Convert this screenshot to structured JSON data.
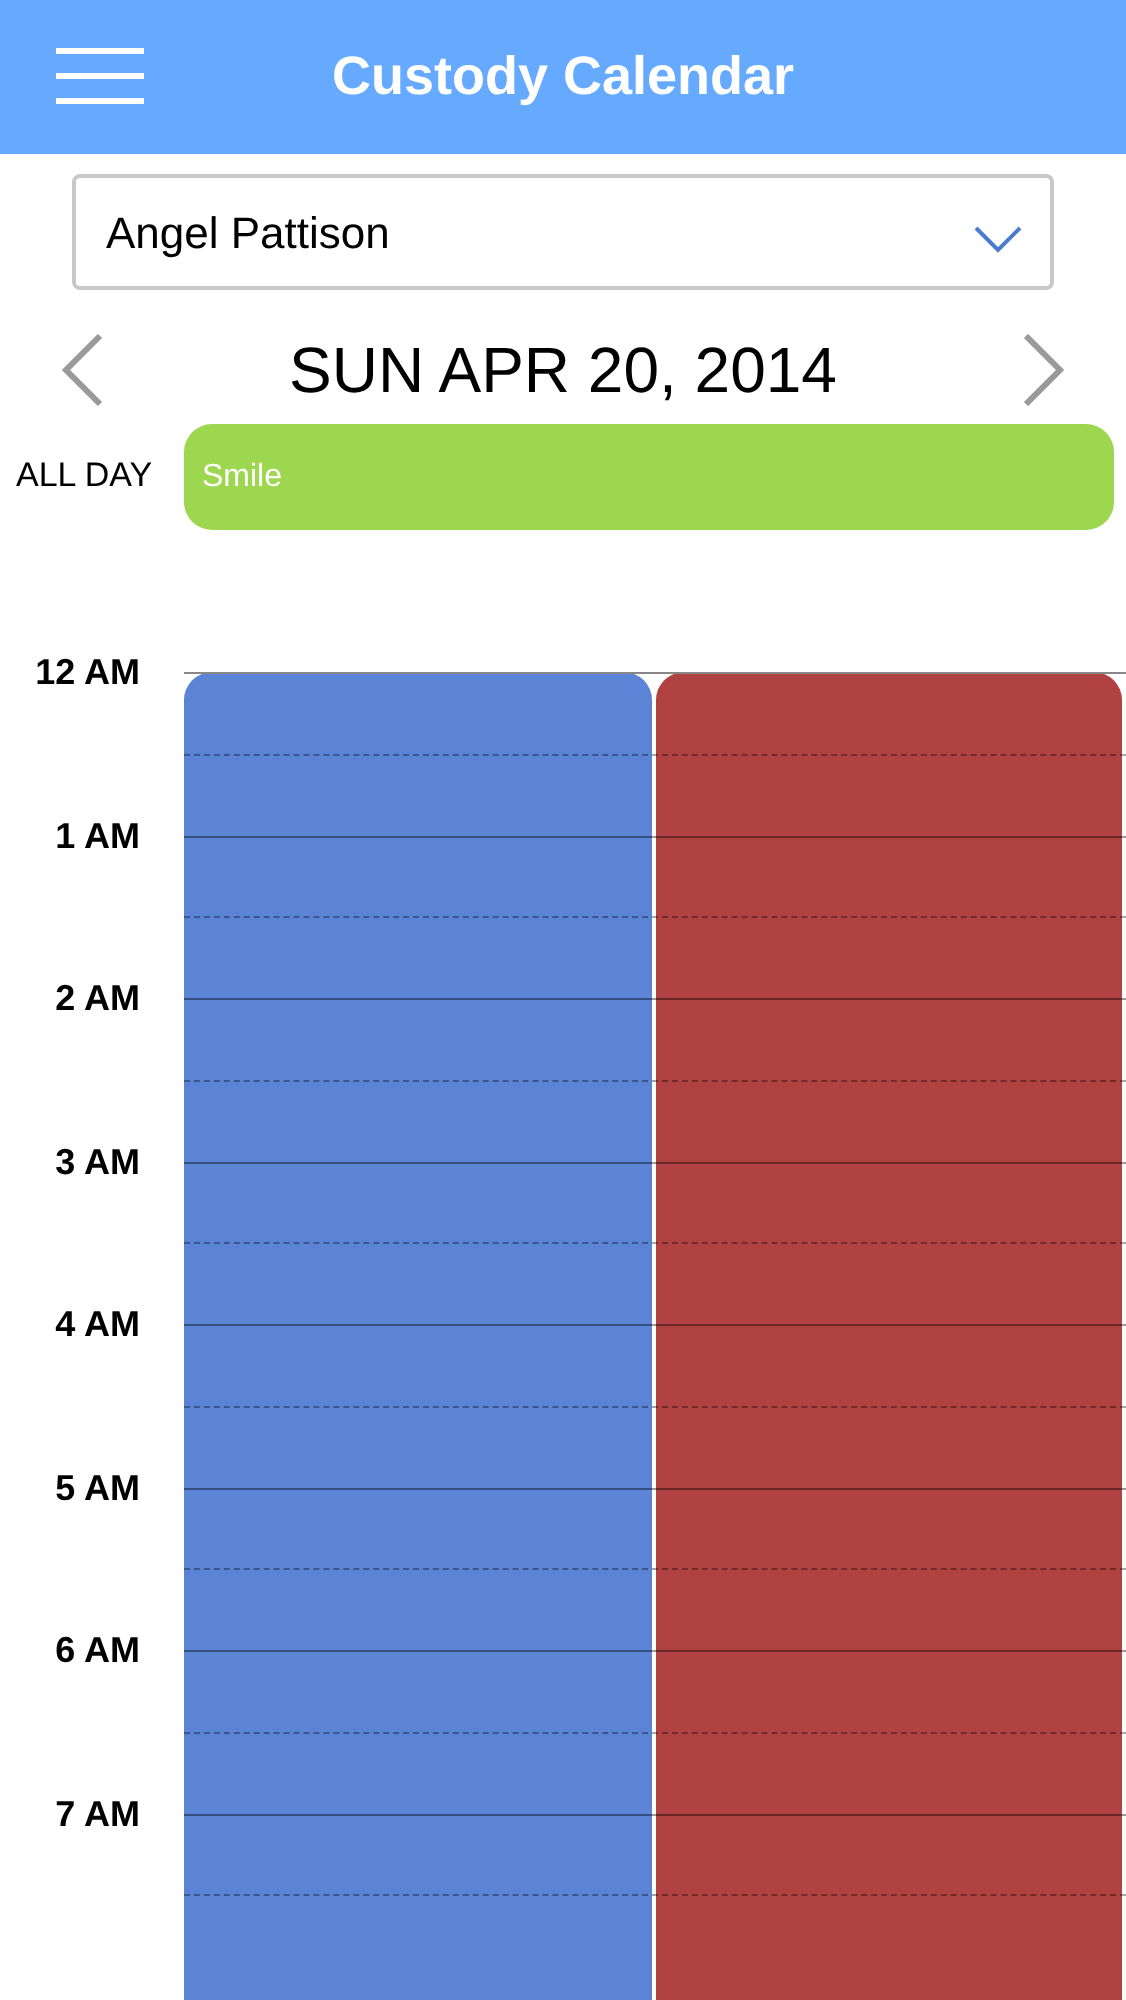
{
  "header": {
    "title": "Custody Calendar"
  },
  "person_select": {
    "value": "Angel Pattison"
  },
  "date_nav": {
    "date": "SUN APR 20, 2014"
  },
  "all_day": {
    "label": "ALL DAY",
    "events": [
      {
        "title": "Smile",
        "color": "#9dd64f"
      }
    ]
  },
  "hours": [
    "12 AM",
    "1 AM",
    "2 AM",
    "3 AM",
    "4 AM",
    "5 AM",
    "6 AM",
    "7 AM"
  ],
  "events": [
    {
      "color": "#5b84d6"
    },
    {
      "color": "#b04242"
    }
  ]
}
